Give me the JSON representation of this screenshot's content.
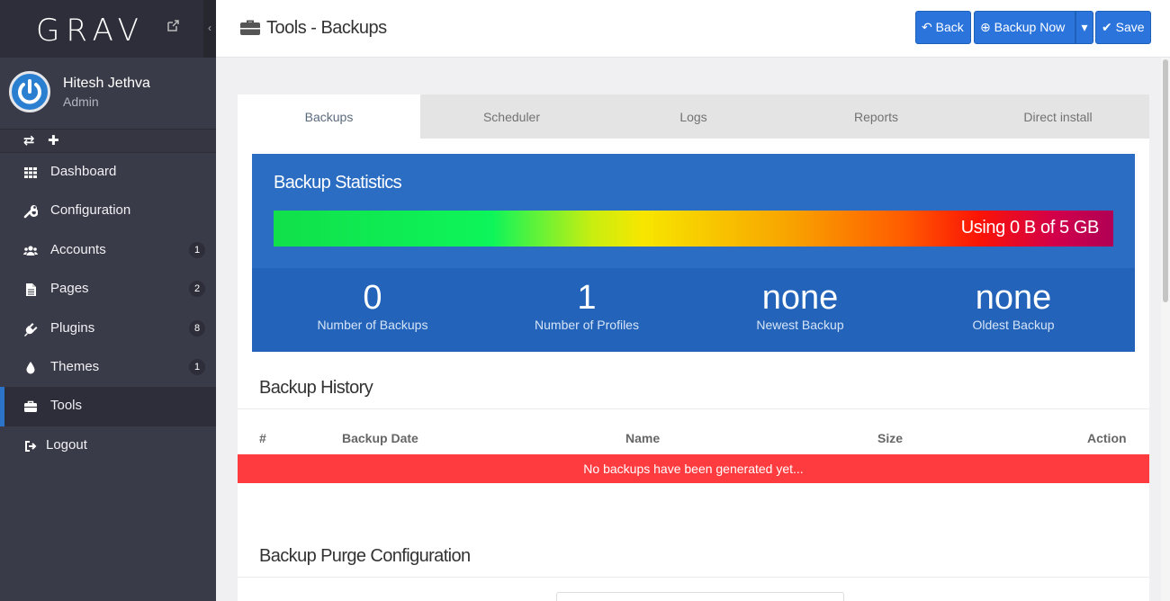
{
  "brand": {
    "logo_text": "GRAV"
  },
  "user": {
    "name": "Hitesh Jethva",
    "role": "Admin"
  },
  "sidebar": {
    "items": [
      {
        "label": "Dashboard",
        "icon": "grid-icon",
        "badge": ""
      },
      {
        "label": "Configuration",
        "icon": "wrench-icon",
        "badge": ""
      },
      {
        "label": "Accounts",
        "icon": "users-icon",
        "badge": "1"
      },
      {
        "label": "Pages",
        "icon": "file-icon",
        "badge": "2"
      },
      {
        "label": "Plugins",
        "icon": "plug-icon",
        "badge": "8"
      },
      {
        "label": "Themes",
        "icon": "droplet-icon",
        "badge": "1"
      },
      {
        "label": "Tools",
        "icon": "briefcase-icon",
        "badge": "",
        "active": true
      },
      {
        "label": "Logout",
        "icon": "sign-out-icon",
        "badge": ""
      }
    ]
  },
  "header": {
    "title": "Tools - Backups",
    "back_label": "Back",
    "backup_now_label": "Backup Now",
    "save_label": "Save"
  },
  "tabs": [
    "Backups",
    "Scheduler",
    "Logs",
    "Reports",
    "Direct install"
  ],
  "stats": {
    "title": "Backup Statistics",
    "usage_text": "Using 0 B of 5 GB",
    "items": [
      {
        "value": "0",
        "caption": "Number of Backups"
      },
      {
        "value": "1",
        "caption": "Number of Profiles"
      },
      {
        "value": "none",
        "caption": "Newest Backup"
      },
      {
        "value": "none",
        "caption": "Oldest Backup"
      }
    ]
  },
  "history": {
    "title": "Backup History",
    "columns": [
      "#",
      "Backup Date",
      "Name",
      "Size",
      "Action"
    ],
    "empty_message": "No backups have been generated yet..."
  },
  "purge": {
    "title": "Backup Purge Configuration"
  },
  "colors": {
    "accent": "#2b74dc",
    "stats_bg": "#2a6dc3",
    "danger": "#fe3b3f",
    "sidebar": "#3a3b48"
  }
}
